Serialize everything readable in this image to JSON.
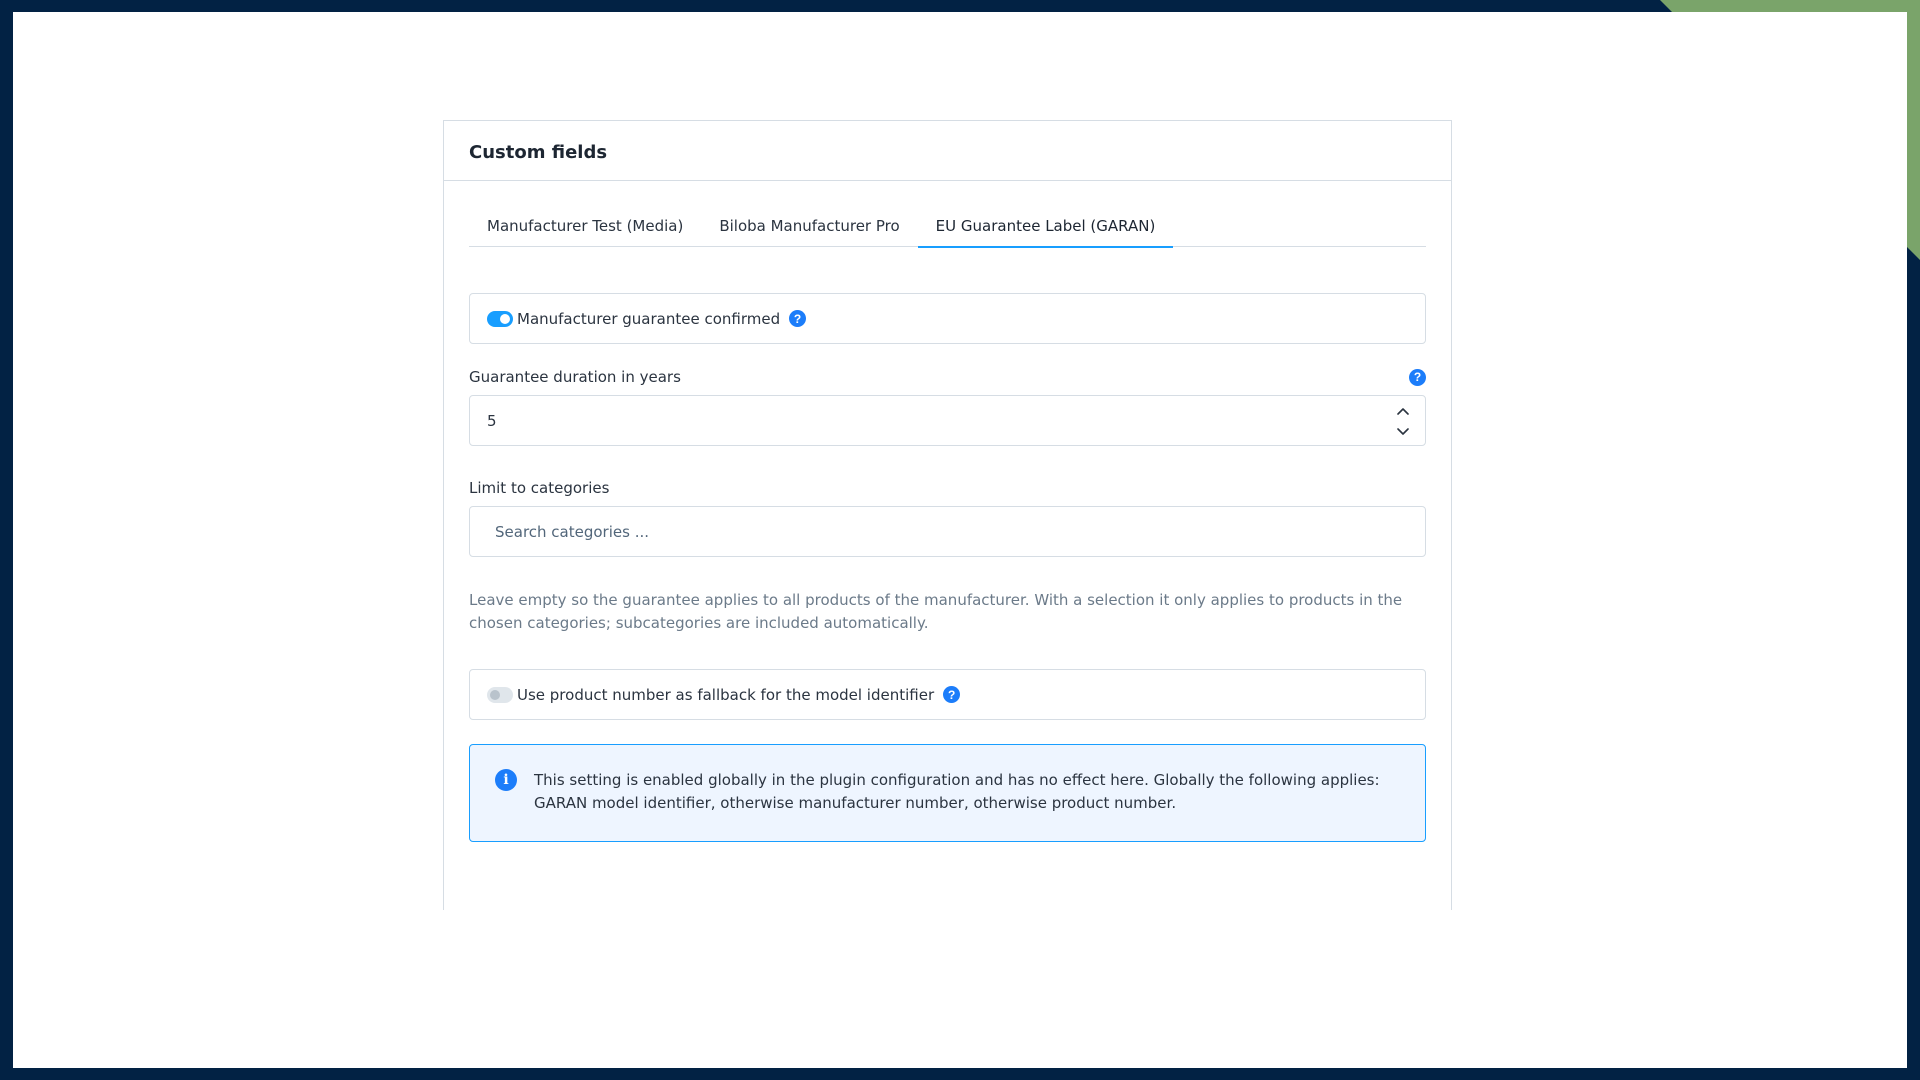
{
  "colors": {
    "frame": "#022244",
    "corner_accent": "#7aa46a",
    "primary": "#189eff",
    "help_icon": "#1c7dfa",
    "alert_bg": "#eef5ff"
  },
  "card": {
    "title": "Custom fields"
  },
  "tabs": [
    {
      "label": "Manufacturer Test (Media)",
      "active": false
    },
    {
      "label": "Biloba Manufacturer Pro",
      "active": false
    },
    {
      "label": "EU Guarantee Label (GARAN)",
      "active": true
    }
  ],
  "guarantee_confirmed": {
    "label": "Manufacturer guarantee confirmed",
    "checked": true,
    "help_icon": "question-mark-icon",
    "help_glyph": "?"
  },
  "guarantee_duration": {
    "label": "Guarantee duration in years",
    "value": "5",
    "help_icon": "question-mark-icon",
    "help_glyph": "?"
  },
  "categories": {
    "label": "Limit to categories",
    "placeholder": "Search categories ...",
    "help_text": "Leave empty so the guarantee applies to all products of the manufacturer. With a selection it only applies to products in the chosen categories; subcategories are included automatically."
  },
  "product_number_fallback": {
    "label": "Use product number as fallback for the model identifier",
    "checked": false,
    "help_icon": "question-mark-icon",
    "help_glyph": "?"
  },
  "alert": {
    "icon": "info-icon",
    "icon_glyph": "i",
    "text": "This setting is enabled globally in the plugin configuration and has no effect here. Globally the following applies: GARAN model identifier, otherwise manufacturer number, otherwise product number."
  }
}
